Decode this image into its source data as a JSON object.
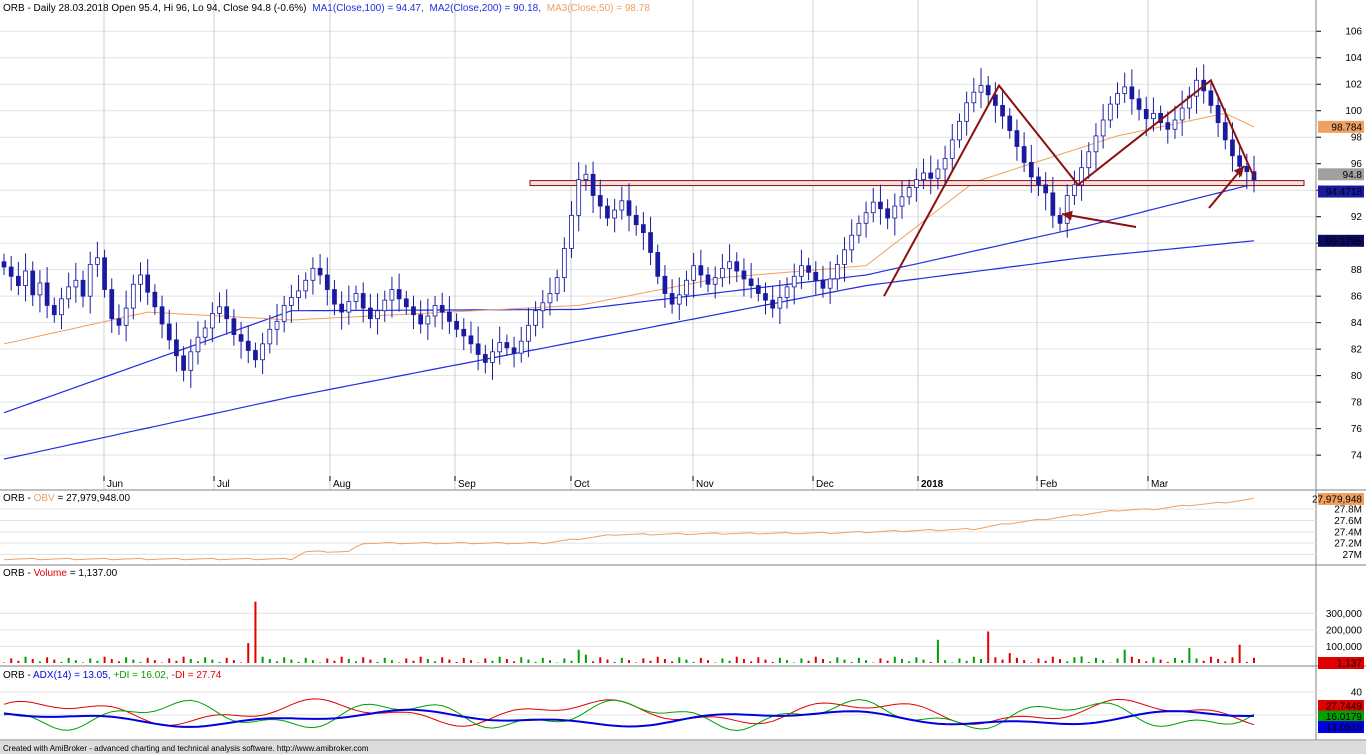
{
  "header": {
    "main_prefix": "ORB - Daily 28.03.2018 Open 95.4, Hi 96, Lo 94, Close 94.8 (-0.6%)",
    "ma1": "MA1(Close,100) = 94.47,",
    "ma2": "MA2(Close,200) = 90.18,",
    "ma3": "MA3(Close,50) = 98.78",
    "obv_prefix": "ORB - ",
    "obv_name": "OBV",
    "obv_value": " = 27,979,948.00",
    "vol_prefix": "ORB - ",
    "vol_name": "Volume",
    "vol_value": " = 1,137.00",
    "adx_prefix": "ORB - ",
    "adx_name": "ADX(14) = 13.05,",
    "pdi_name": "+DI = 16.02,",
    "mdi_name": "-DI = 27.74"
  },
  "footer": "Created with AmiBroker - advanced charting and technical analysis software. http://www.amibroker.com",
  "colors": {
    "candle_down": "#1a1aa0",
    "candle_up": "#ffffff",
    "ma1": "#1f2ee0",
    "ma2": "#1f2ee0",
    "ma3": "#f0a060",
    "obv": "#f0a060",
    "trend": "#8b1010",
    "vol_up": "#00a000",
    "vol_down": "#e00000",
    "adx": "#0000e0",
    "pdi": "#00a000",
    "mdi": "#e00000"
  },
  "chart_data": [
    {
      "type": "candlestick",
      "ylim": [
        72.5,
        107
      ],
      "yticks": [
        "74",
        "76",
        "78",
        "80",
        "82",
        "84",
        "86",
        "88",
        "90",
        "92",
        "94",
        "96",
        "98",
        "100",
        "102",
        "104",
        "106"
      ],
      "months": [
        "Jun",
        "Jul",
        "Aug",
        "Sep",
        "Oct",
        "Nov",
        "Dec",
        "2018",
        "Feb",
        "Mar"
      ],
      "last_labels": {
        "close": "94.8",
        "ma1": "94.4718",
        "ma2": "90.1795",
        "ma3": "98.784"
      },
      "support_level": 94.5,
      "trend_lines": [
        {
          "points": [
            [
              86.0,
              86.0
            ],
            [
              101.9,
              101.9
            ],
            [
              94.4,
              94.4
            ],
            [
              102.3,
              102.3
            ],
            [
              95.0,
              95.0
            ]
          ]
        }
      ],
      "closes": [
        88.2,
        87.5,
        86.8,
        87.9,
        86.1,
        87.0,
        85.3,
        84.6,
        85.8,
        86.7,
        87.2,
        86.0,
        88.4,
        88.9,
        86.5,
        84.3,
        83.8,
        85.1,
        86.9,
        87.6,
        86.3,
        85.2,
        83.9,
        82.7,
        81.5,
        80.4,
        81.8,
        82.9,
        83.6,
        84.7,
        85.2,
        84.3,
        83.1,
        82.6,
        81.9,
        81.2,
        82.4,
        83.5,
        84.1,
        85.3,
        85.9,
        86.4,
        87.2,
        88.1,
        87.6,
        86.5,
        85.4,
        84.8,
        85.6,
        86.2,
        85.1,
        84.3,
        84.9,
        85.7,
        86.5,
        85.8,
        85.2,
        84.6,
        83.9,
        84.5,
        85.3,
        84.8,
        84.1,
        83.5,
        83.0,
        82.4,
        81.6,
        81.0,
        81.8,
        82.5,
        82.1,
        81.7,
        82.6,
        83.8,
        84.9,
        85.5,
        86.2,
        87.4,
        89.6,
        92.1,
        94.8,
        95.2,
        93.6,
        92.8,
        91.9,
        92.5,
        93.2,
        92.1,
        91.4,
        90.8,
        89.3,
        87.5,
        86.2,
        85.4,
        86.1,
        87.2,
        88.3,
        87.6,
        86.9,
        87.4,
        88.1,
        88.6,
        87.9,
        87.3,
        86.8,
        86.2,
        85.7,
        85.1,
        85.9,
        86.7,
        87.5,
        88.3,
        87.8,
        87.2,
        86.6,
        87.3,
        88.4,
        89.5,
        90.6,
        91.5,
        92.3,
        93.1,
        92.6,
        91.9,
        92.8,
        93.5,
        94.2,
        94.8,
        95.3,
        94.9,
        95.6,
        96.4,
        97.8,
        99.2,
        100.6,
        101.4,
        101.9,
        101.2,
        100.4,
        99.6,
        98.5,
        97.3,
        96.1,
        95.0,
        94.4,
        93.8,
        92.1,
        91.5,
        93.6,
        94.4,
        95.7,
        96.9,
        98.1,
        99.3,
        100.5,
        101.3,
        101.8,
        100.9,
        100.1,
        99.4,
        99.8,
        99.1,
        98.6,
        99.3,
        100.2,
        101.1,
        102.3,
        101.5,
        100.4,
        99.1,
        97.8,
        96.6,
        95.8,
        95.4,
        94.8
      ],
      "ma1_anchor": [
        [
          0,
          77.2
        ],
        [
          40,
          84.9
        ],
        [
          80,
          85.0
        ],
        [
          120,
          87.6
        ],
        [
          150,
          91.2
        ],
        [
          174,
          94.47
        ]
      ],
      "ma2_anchor": [
        [
          0,
          73.7
        ],
        [
          40,
          78.4
        ],
        [
          80,
          82.6
        ],
        [
          120,
          86.8
        ],
        [
          150,
          88.9
        ],
        [
          174,
          90.18
        ]
      ],
      "ma3_anchor": [
        [
          0,
          82.4
        ],
        [
          20,
          84.8
        ],
        [
          40,
          84.2
        ],
        [
          80,
          85.3
        ],
        [
          100,
          87.4
        ],
        [
          120,
          88.3
        ],
        [
          135,
          94.6
        ],
        [
          155,
          98.1
        ],
        [
          170,
          99.8
        ],
        [
          174,
          98.78
        ]
      ]
    },
    {
      "type": "line",
      "name_ref": "obv",
      "yticks": [
        "27M",
        "27.2M",
        "27.4M",
        "27.6M",
        "27.8M"
      ],
      "last_label": "27,979,948",
      "ylim": [
        26.85,
        28.05
      ]
    },
    {
      "type": "bar",
      "name_ref": "volume",
      "yticks": [
        "100,000",
        "200,000",
        "300,000"
      ],
      "last_label": "1,137",
      "ylim": [
        0,
        380000
      ]
    },
    {
      "type": "line",
      "name_ref": "adx",
      "yticks": [
        "20",
        "40"
      ],
      "last_labels": {
        "mdi": "27.7449",
        "pdi": "16.0179",
        "adx": "13.0515"
      },
      "ylim": [
        0,
        52
      ]
    }
  ]
}
